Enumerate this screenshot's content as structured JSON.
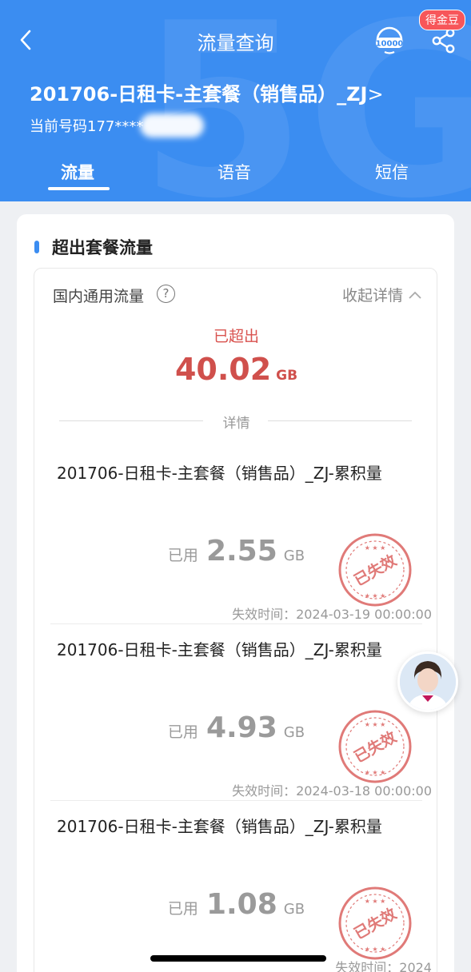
{
  "header": {
    "title": "流量查询",
    "badge": "得金豆",
    "service_icon_text": "10000",
    "plan_name": "201706-日租卡-主套餐（销售品）_ZJ",
    "plan_chevron": ">",
    "phone_label": "当前号码177****",
    "tabs": [
      {
        "label": "流量",
        "active": true
      },
      {
        "label": "语音",
        "active": false
      },
      {
        "label": "短信",
        "active": false
      }
    ]
  },
  "section": {
    "title": "超出套餐流量",
    "domestic_label": "国内通用流量",
    "help_glyph": "?",
    "collapse_label": "收起详情",
    "exceeded_label": "已超出",
    "exceeded_value": "40.02",
    "exceeded_unit": "GB",
    "details_label": "详情"
  },
  "items": [
    {
      "name": "201706-日租卡-主套餐（销售品）_ZJ-累积量",
      "used_label": "已用",
      "used_value": "2.55",
      "unit": "GB",
      "stamp": "已失效",
      "expire": "失效时间：2024-03-19 00:00:00"
    },
    {
      "name": "201706-日租卡-主套餐（销售品）_ZJ-累积量",
      "used_label": "已用",
      "used_value": "4.93",
      "unit": "GB",
      "stamp": "已失效",
      "expire": "失效时间：2024-03-18 00:00:00"
    },
    {
      "name": "201706-日租卡-主套餐（销售品）_ZJ-累积量",
      "used_label": "已用",
      "used_value": "1.08",
      "unit": "GB",
      "stamp": "已失效",
      "expire": "失效时间：2024"
    }
  ],
  "colors": {
    "header_bg": "#3b8df1",
    "exceeded": "#d0504c",
    "stamp": "#e07a78",
    "badge": "#f7565a"
  }
}
